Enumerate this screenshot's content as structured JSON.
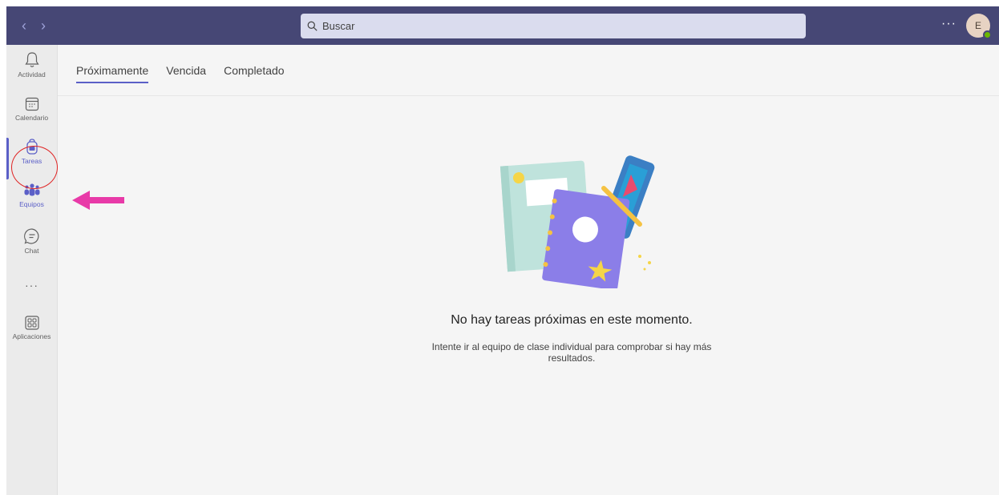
{
  "search": {
    "placeholder": "Buscar"
  },
  "user": {
    "initial": "E"
  },
  "top_more": "···",
  "rail": [
    {
      "label": "Actividad",
      "icon": "bell-icon"
    },
    {
      "label": "Calendario",
      "icon": "calendar-icon"
    },
    {
      "label": "Tareas",
      "icon": "backpack-icon"
    },
    {
      "label": "Equipos",
      "icon": "teams-icon"
    },
    {
      "label": "Chat",
      "icon": "chat-icon"
    },
    {
      "label": "···",
      "icon": "more-icon"
    },
    {
      "label": "Aplicaciones",
      "icon": "apps-icon"
    }
  ],
  "tabs": [
    {
      "label": "Próximamente",
      "active": true
    },
    {
      "label": "Vencida",
      "active": false
    },
    {
      "label": "Completado",
      "active": false
    }
  ],
  "empty": {
    "title": "No hay tareas próximas en este momento.",
    "subtitle": "Intente ir al equipo de clase individual para comprobar si hay más resultados."
  },
  "colors": {
    "topbar": "#464775",
    "accent": "#5b5fc7",
    "annotation_circle": "#e02424",
    "annotation_arrow": "#e83aa8"
  }
}
